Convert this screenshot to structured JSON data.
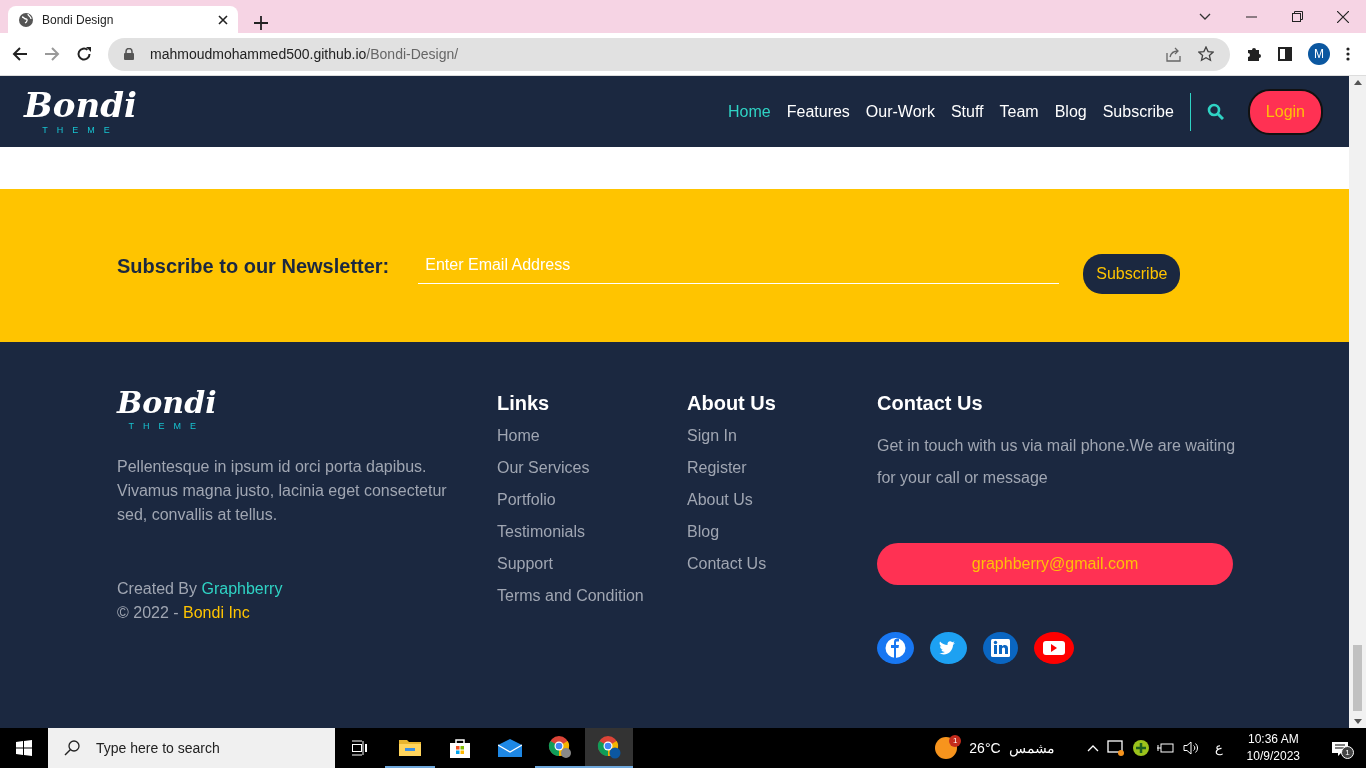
{
  "browser": {
    "tab_title": "Bondi Design",
    "url_host": "mahmoudmohammed500.github.io",
    "url_path": "/Bondi-Design/",
    "profile_initial": "M"
  },
  "navbar": {
    "logo": {
      "name": "Bondi",
      "tagline": "THEME"
    },
    "links": [
      {
        "label": "Home",
        "selected": true
      },
      {
        "label": "Features",
        "selected": false
      },
      {
        "label": "Our-Work",
        "selected": false
      },
      {
        "label": "Stuff",
        "selected": false
      },
      {
        "label": "Team",
        "selected": false
      },
      {
        "label": "Blog",
        "selected": false
      },
      {
        "label": "Subscribe",
        "selected": false
      }
    ],
    "login": "Login"
  },
  "newsletter": {
    "label": "Subscribe to our Newsletter:",
    "placeholder": "Enter Email Address",
    "button": "Subscribe"
  },
  "footer": {
    "logo": {
      "name": "Bondi",
      "tagline": "THEME"
    },
    "about": "Pellentesque in ipsum id orci porta dapibus. Vivamus magna justo, lacinia eget consectetur sed, convallis at tellus.",
    "credit": {
      "prefix": "Created By ",
      "link": "Graphberry"
    },
    "copyright": {
      "prefix": "© 2022 - ",
      "link": "Bondi Inc"
    },
    "columns": [
      {
        "title": "Links",
        "links": [
          "Home",
          "Our Services",
          "Portfolio",
          "Testimonials",
          "Support",
          "Terms and Condition"
        ]
      },
      {
        "title": "About Us",
        "links": [
          "Sign In",
          "Register",
          "About Us",
          "Blog",
          "Contact Us"
        ]
      }
    ],
    "contact": {
      "title": "Contact Us",
      "text": "Get in touch with us via mail phone.We are waiting for your call or message",
      "email": "graphberry@gmail.com"
    }
  },
  "taskbar": {
    "search_placeholder": "Type here to search",
    "weather_badge": "1",
    "temperature": "26°C",
    "weather_label": "مشمس",
    "language": "ع",
    "time": "10:36 AM",
    "date": "10/9/2023",
    "notification_count": "1"
  }
}
